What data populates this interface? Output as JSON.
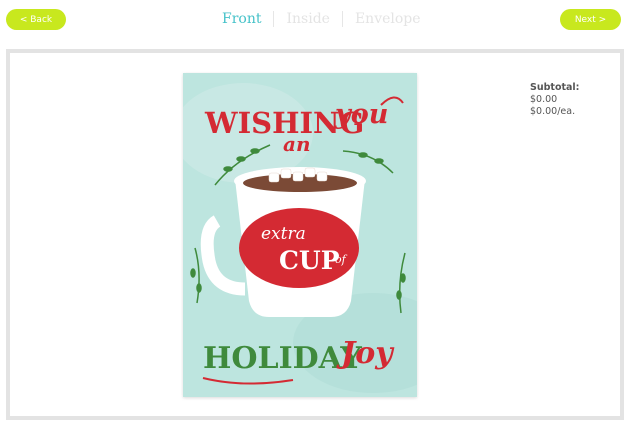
{
  "nav": {
    "back_label": "< Back",
    "next_label": "Next >"
  },
  "tabs": [
    {
      "label": "Front",
      "active": true
    },
    {
      "label": "Inside",
      "active": false
    },
    {
      "label": "Envelope",
      "active": false
    }
  ],
  "card": {
    "line1_a": "WISHING",
    "line1_b": "you",
    "line2": "an",
    "cup_line1": "extra",
    "cup_line2": "CUP",
    "cup_line3": "of",
    "line3_a": "HOLIDAY",
    "line3_b": "Joy"
  },
  "pricing": {
    "subtotal_label": "Subtotal:",
    "subtotal_value": "$0.00",
    "per_each": "$0.00/ea."
  },
  "colors": {
    "accent_green": "#c8e81e",
    "tab_active": "#45c2c9",
    "card_bg": "#bde5df",
    "card_red": "#d42a33",
    "card_green": "#3f8a3c"
  }
}
